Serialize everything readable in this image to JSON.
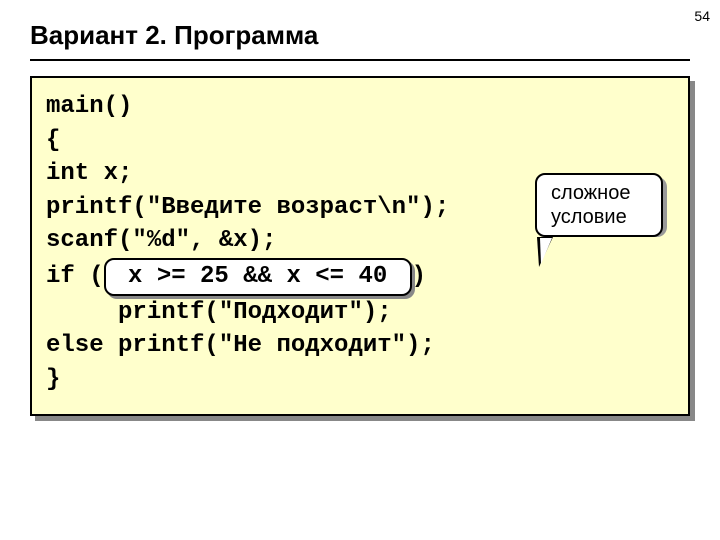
{
  "page_number": "54",
  "title": "Вариант 2. Программа",
  "callout": {
    "line1": "сложное",
    "line2": "условие"
  },
  "code": {
    "l1": "main()",
    "l2": "{",
    "l3": "int x;",
    "l4": "printf(\"Введите возраст\\n\");",
    "l5": "scanf(\"%d\", &x);",
    "l6a": "if (",
    "l6b": " x >= 25 && x <= 40 ",
    "l6c": ")",
    "l7": "     printf(\"Подходит\");",
    "l8": "else printf(\"Не подходит\");",
    "l9": "}"
  }
}
